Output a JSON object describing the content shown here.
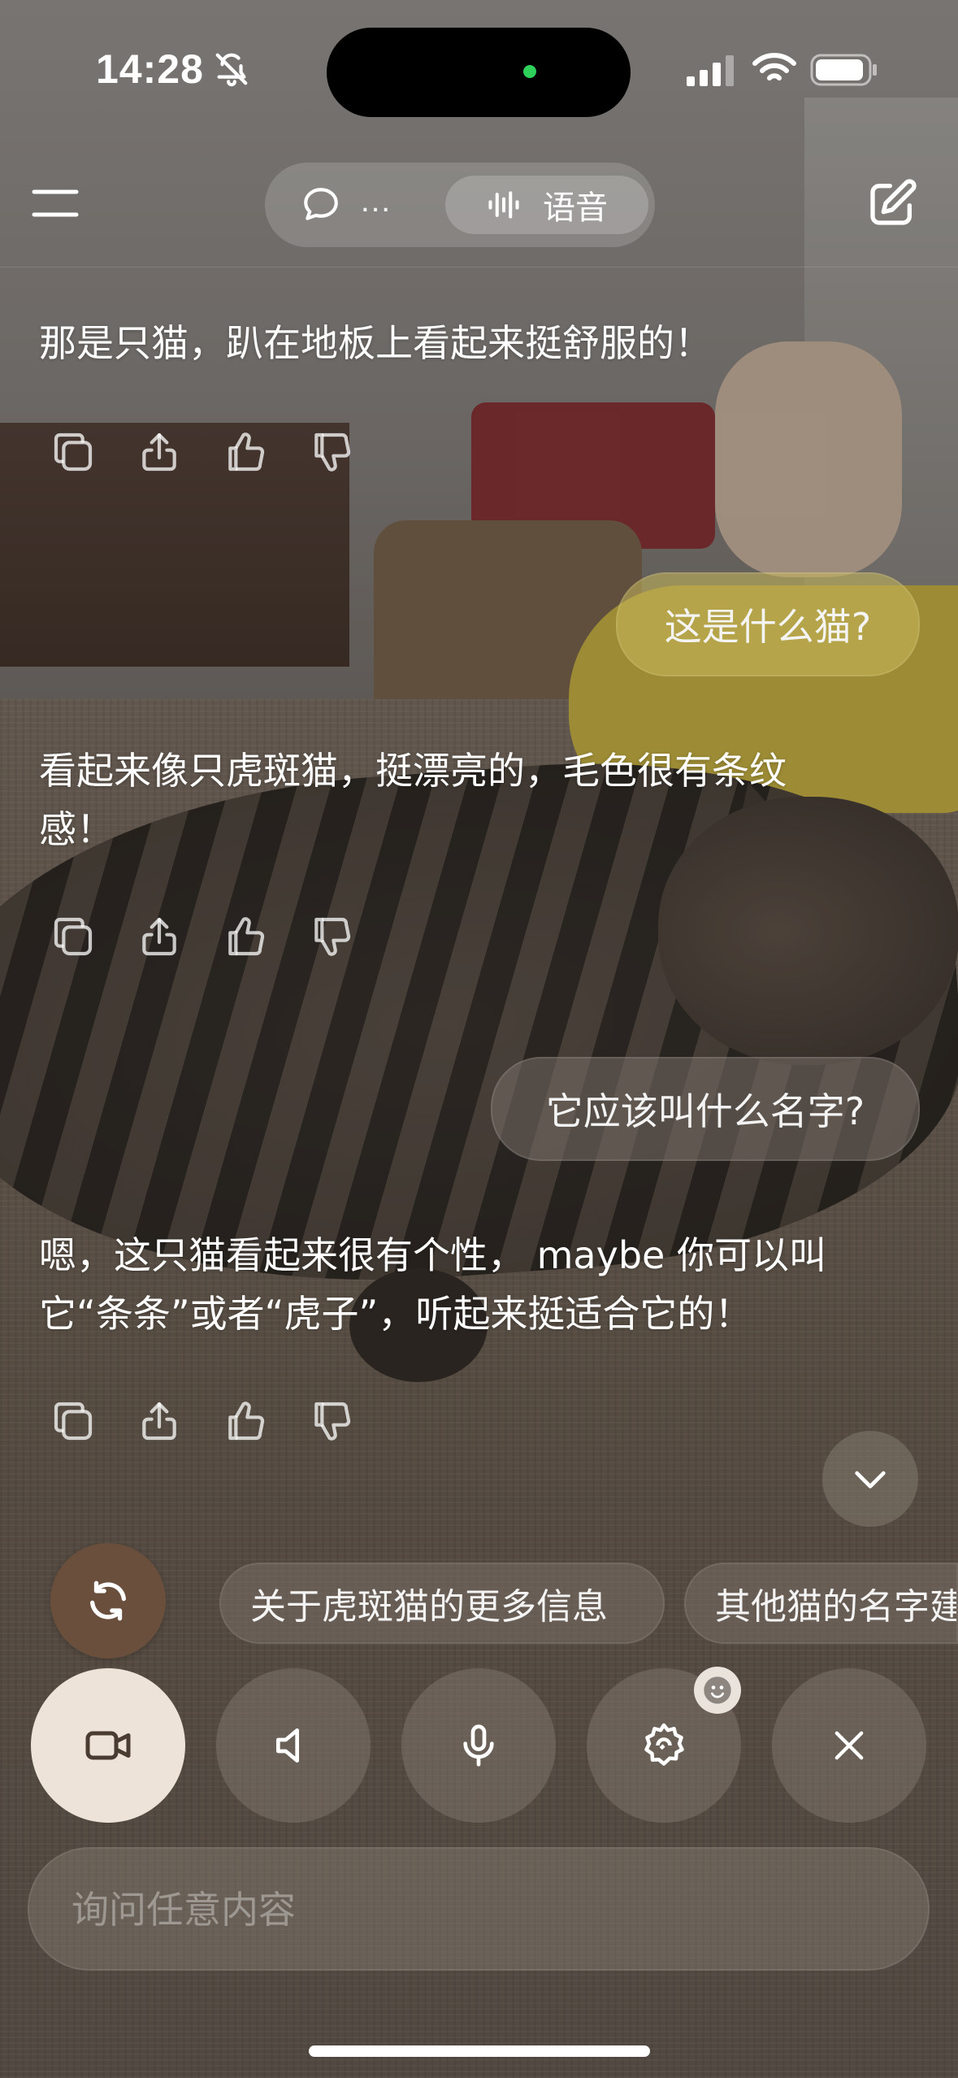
{
  "status_bar": {
    "time": "14:28"
  },
  "header": {
    "mode_chat_label": "…",
    "mode_voice_label": "语音"
  },
  "messages": [
    {
      "role": "assistant",
      "text": "那是只猫，趴在地板上看起来挺舒服的！"
    },
    {
      "role": "user",
      "text": "这是什么猫?"
    },
    {
      "role": "assistant",
      "text": "看起来像只虎斑猫，挺漂亮的，毛色很有条纹感！"
    },
    {
      "role": "user",
      "text": "它应该叫什么名字?"
    },
    {
      "role": "assistant",
      "text": "嗯，这只猫看起来很有个性， maybe 你可以叫它“条条”或者“虎子”，听起来挺适合它的！"
    }
  ],
  "suggestions": [
    "关于虎斑猫的更多信息",
    "其他猫的名字建议"
  ],
  "input": {
    "placeholder": "询问任意内容",
    "value": ""
  },
  "icons": {
    "menu": "menu-icon",
    "chat": "chat-bubble-icon",
    "voice": "waveform-icon",
    "edit": "compose-icon",
    "copy": "copy-icon",
    "share": "share-icon",
    "like": "thumbs-up-icon",
    "dislike": "thumbs-down-icon",
    "scroll_down": "chevron-down-icon",
    "refresh": "refresh-icon",
    "camera": "video-camera-icon",
    "speaker": "speaker-icon",
    "mic": "microphone-icon",
    "settings": "settings-icon",
    "close": "close-icon",
    "emoji": "smiley-icon"
  },
  "colors": {
    "camera_button_bg": "#ede3d8",
    "refresh_button_bg": "#6a4f3d",
    "island_dot": "#2fd05a"
  }
}
